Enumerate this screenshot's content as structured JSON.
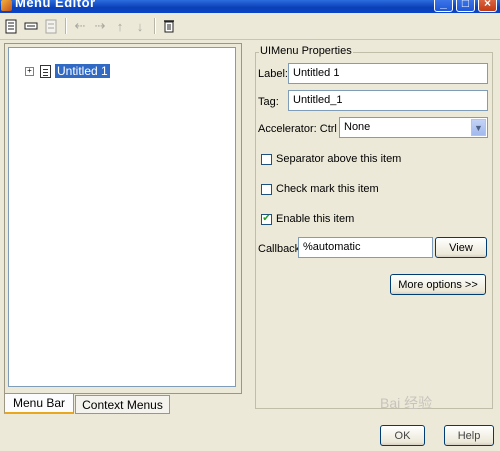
{
  "window": {
    "title": "Menu Editor",
    "controls": {
      "minimize": "_",
      "maximize": "□",
      "close": "×"
    }
  },
  "toolbar": {
    "tools": [
      {
        "icon": "new-menu-icon",
        "enabled": true
      },
      {
        "icon": "new-menu-item-icon",
        "enabled": true
      },
      {
        "icon": "new-context-menu-icon",
        "enabled": false
      },
      {
        "icon": "move-left-arrow-icon",
        "enabled": false
      },
      {
        "icon": "move-right-arrow-icon",
        "enabled": false
      },
      {
        "icon": "move-up-arrow-icon",
        "enabled": false
      },
      {
        "icon": "move-down-arrow-icon",
        "enabled": false
      },
      {
        "icon": "delete-icon",
        "enabled": true
      }
    ]
  },
  "tree": {
    "items": [
      {
        "label": "Untitled 1",
        "expanded": false,
        "selected": true
      }
    ]
  },
  "tabs": [
    {
      "label": "Menu Bar",
      "active": true
    },
    {
      "label": "Context Menus",
      "active": false
    }
  ],
  "properties": {
    "legend": "UIMenu Properties",
    "label_field": {
      "label": "Label:",
      "value": "Untitled 1"
    },
    "tag_field": {
      "label": "Tag:",
      "value": "Untitled_1"
    },
    "accelerator": {
      "label": "Accelerator: Ctrl +",
      "value": "None"
    },
    "checkboxes": [
      {
        "label": "Separator above this item",
        "checked": false
      },
      {
        "label": "Check mark this item",
        "checked": false
      },
      {
        "label": "Enable this item",
        "checked": true
      }
    ],
    "callback": {
      "label": "Callback:",
      "value": "%automatic",
      "view_button": "View"
    },
    "more_options_button": "More options >>"
  },
  "footer": {
    "ok_button": "OK",
    "help_button": "Help"
  },
  "watermark": "Bai 经验"
}
